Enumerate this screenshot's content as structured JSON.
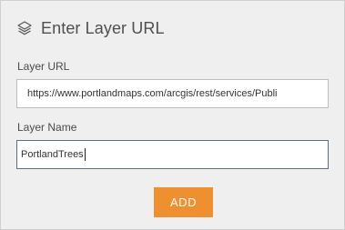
{
  "header": {
    "icon": "layers-icon",
    "title": "Enter Layer URL"
  },
  "fields": {
    "layer_url": {
      "label": "Layer URL",
      "value": "https://www.portlandmaps.com/arcgis/rest/services/Publi"
    },
    "layer_name": {
      "label": "Layer Name",
      "value": "PortlandTrees"
    }
  },
  "actions": {
    "add_label": "ADD"
  },
  "colors": {
    "accent": "#ee8f30",
    "panel_bg": "#efefef",
    "focus_border": "#5a6f86"
  }
}
